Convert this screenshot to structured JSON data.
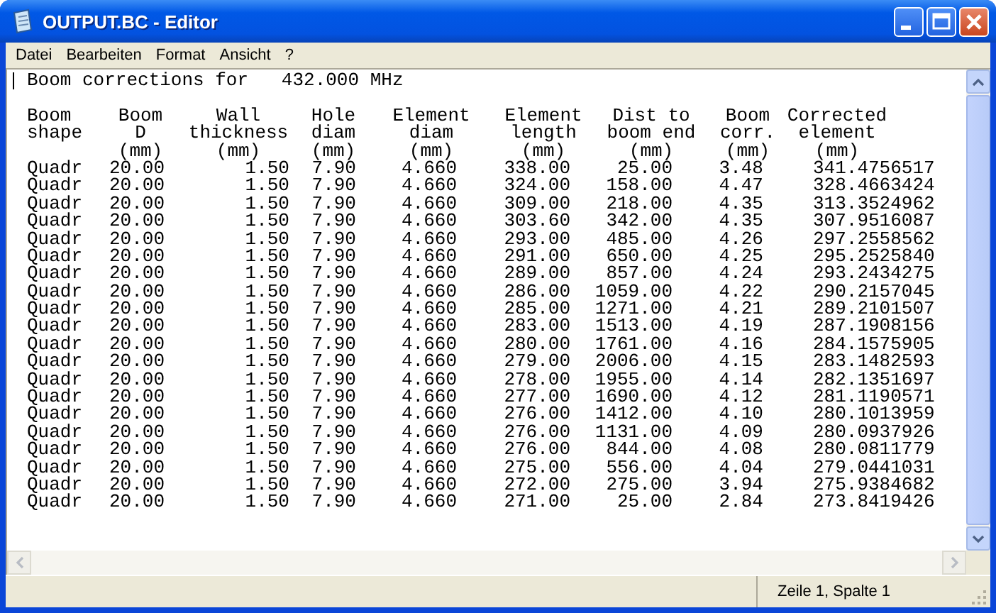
{
  "window": {
    "title": "OUTPUT.BC - Editor"
  },
  "menu": [
    "Datei",
    "Bearbeiten",
    "Format",
    "Ansicht",
    "?"
  ],
  "document": {
    "heading": "Boom corrections for   432.000 MHz",
    "columns": [
      {
        "header": [
          "Boom",
          "shape"
        ]
      },
      {
        "header": [
          "Boom",
          "D",
          "(mm)"
        ]
      },
      {
        "header": [
          "Wall",
          "thickness",
          "(mm)"
        ]
      },
      {
        "header": [
          "Hole",
          "diam",
          "(mm)"
        ]
      },
      {
        "header": [
          "Element",
          "diam",
          "(mm)"
        ]
      },
      {
        "header": [
          "Element",
          "length",
          "(mm)"
        ]
      },
      {
        "header": [
          "Dist to",
          "boom end",
          "(mm)"
        ]
      },
      {
        "header": [
          "Boom",
          "corr.",
          "(mm)"
        ]
      },
      {
        "header": [
          "Corrected",
          "element",
          "(mm)"
        ]
      }
    ],
    "rows": [
      [
        "Quadr",
        "20.00",
        "1.50",
        "7.90",
        "4.660",
        "338.00",
        "25.00",
        "3.48",
        "341.4756517"
      ],
      [
        "Quadr",
        "20.00",
        "1.50",
        "7.90",
        "4.660",
        "324.00",
        "158.00",
        "4.47",
        "328.4663424"
      ],
      [
        "Quadr",
        "20.00",
        "1.50",
        "7.90",
        "4.660",
        "309.00",
        "218.00",
        "4.35",
        "313.3524962"
      ],
      [
        "Quadr",
        "20.00",
        "1.50",
        "7.90",
        "4.660",
        "303.60",
        "342.00",
        "4.35",
        "307.9516087"
      ],
      [
        "Quadr",
        "20.00",
        "1.50",
        "7.90",
        "4.660",
        "293.00",
        "485.00",
        "4.26",
        "297.2558562"
      ],
      [
        "Quadr",
        "20.00",
        "1.50",
        "7.90",
        "4.660",
        "291.00",
        "650.00",
        "4.25",
        "295.2525840"
      ],
      [
        "Quadr",
        "20.00",
        "1.50",
        "7.90",
        "4.660",
        "289.00",
        "857.00",
        "4.24",
        "293.2434275"
      ],
      [
        "Quadr",
        "20.00",
        "1.50",
        "7.90",
        "4.660",
        "286.00",
        "1059.00",
        "4.22",
        "290.2157045"
      ],
      [
        "Quadr",
        "20.00",
        "1.50",
        "7.90",
        "4.660",
        "285.00",
        "1271.00",
        "4.21",
        "289.2101507"
      ],
      [
        "Quadr",
        "20.00",
        "1.50",
        "7.90",
        "4.660",
        "283.00",
        "1513.00",
        "4.19",
        "287.1908156"
      ],
      [
        "Quadr",
        "20.00",
        "1.50",
        "7.90",
        "4.660",
        "280.00",
        "1761.00",
        "4.16",
        "284.1575905"
      ],
      [
        "Quadr",
        "20.00",
        "1.50",
        "7.90",
        "4.660",
        "279.00",
        "2006.00",
        "4.15",
        "283.1482593"
      ],
      [
        "Quadr",
        "20.00",
        "1.50",
        "7.90",
        "4.660",
        "278.00",
        "1955.00",
        "4.14",
        "282.1351697"
      ],
      [
        "Quadr",
        "20.00",
        "1.50",
        "7.90",
        "4.660",
        "277.00",
        "1690.00",
        "4.12",
        "281.1190571"
      ],
      [
        "Quadr",
        "20.00",
        "1.50",
        "7.90",
        "4.660",
        "276.00",
        "1412.00",
        "4.10",
        "280.1013959"
      ],
      [
        "Quadr",
        "20.00",
        "1.50",
        "7.90",
        "4.660",
        "276.00",
        "1131.00",
        "4.09",
        "280.0937926"
      ],
      [
        "Quadr",
        "20.00",
        "1.50",
        "7.90",
        "4.660",
        "276.00",
        "844.00",
        "4.08",
        "280.0811779"
      ],
      [
        "Quadr",
        "20.00",
        "1.50",
        "7.90",
        "4.660",
        "275.00",
        "556.00",
        "4.04",
        "279.0441031"
      ],
      [
        "Quadr",
        "20.00",
        "1.50",
        "7.90",
        "4.660",
        "272.00",
        "275.00",
        "3.94",
        "275.9384682"
      ],
      [
        "Quadr",
        "20.00",
        "1.50",
        "7.90",
        "4.660",
        "271.00",
        "25.00",
        "2.84",
        "273.8419426"
      ]
    ]
  },
  "status_bar": {
    "position": "Zeile 1, Spalte 1"
  }
}
